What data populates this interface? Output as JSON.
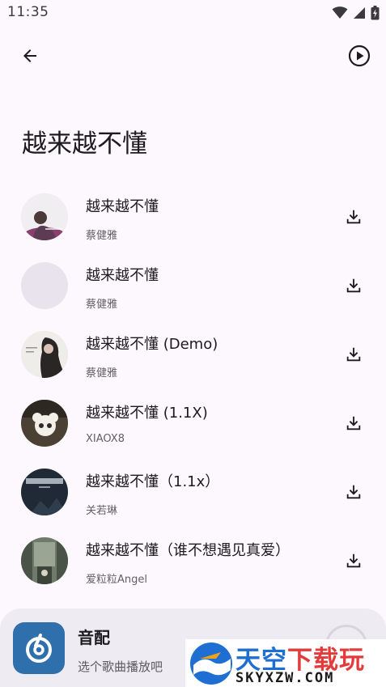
{
  "status_bar": {
    "time": "11:35"
  },
  "page": {
    "title": "越来越不懂"
  },
  "songs": [
    {
      "title": "越来越不懂",
      "artist": "蔡健雅",
      "cover": "portrait-woman-pink"
    },
    {
      "title": "越来越不懂",
      "artist": "蔡健雅",
      "cover": "placeholder"
    },
    {
      "title": "越来越不懂 (Demo)",
      "artist": "蔡健雅",
      "cover": "woman-dark-hair"
    },
    {
      "title": "越来越不懂 (1.1X)",
      "artist": "XIAOX8",
      "cover": "plush-toy"
    },
    {
      "title": "越来越不懂（1.1x）",
      "artist": "关若琳",
      "cover": "text-dark-blue"
    },
    {
      "title": "越来越不懂（谁不想遇见真爱）",
      "artist": "爱粒粒Angel",
      "cover": "street-scene"
    }
  ],
  "mini_player": {
    "title": "音配",
    "subtitle": "选个歌曲播放吧"
  },
  "watermark": {
    "title_part1": "天空",
    "title_part2": "下载玩",
    "domain": "SKYXZW.COM"
  },
  "colors": {
    "background": "#fcf8fd",
    "player_bg": "#efebf2",
    "logo_bg": "#2f6fab",
    "watermark_blue": "#1e6fd1",
    "watermark_red": "#e23b3b"
  }
}
